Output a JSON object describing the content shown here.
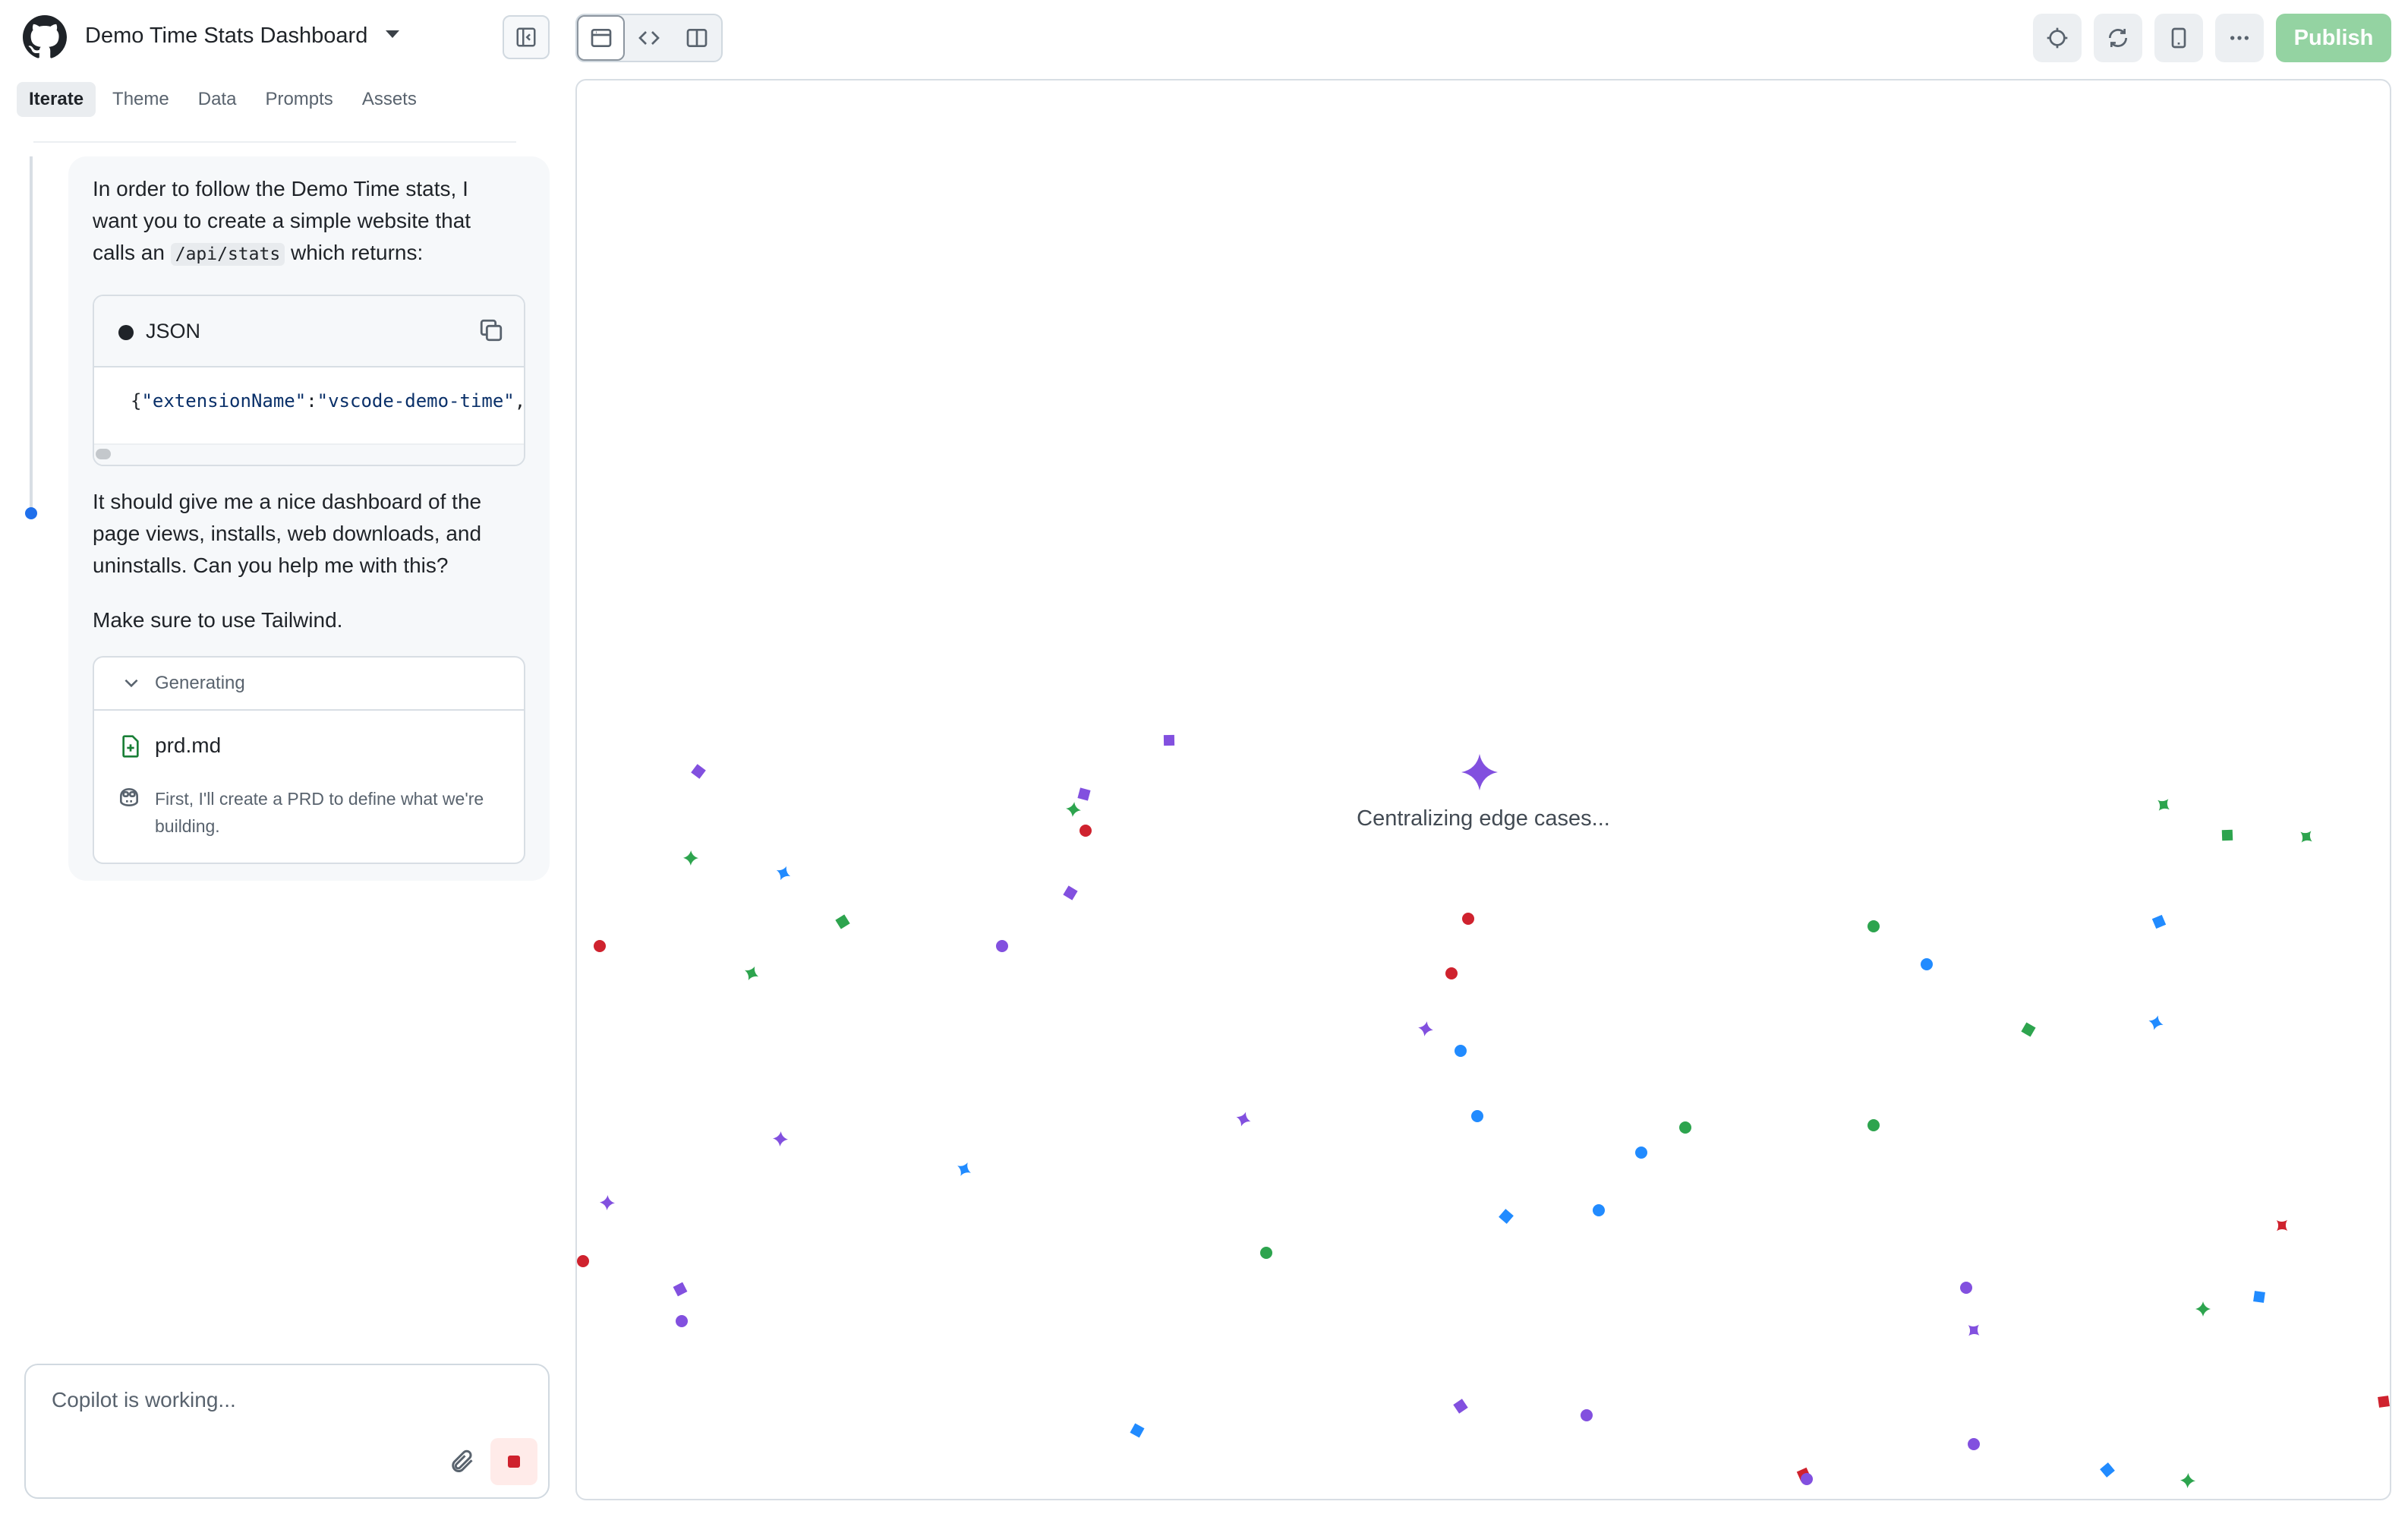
{
  "header": {
    "app_title": "Demo Time Stats Dashboard",
    "publish_label": "Publish",
    "publish_color": "#94d3a2"
  },
  "tabs": [
    {
      "label": "Iterate",
      "active": true
    },
    {
      "label": "Theme",
      "active": false
    },
    {
      "label": "Data",
      "active": false
    },
    {
      "label": "Prompts",
      "active": false
    },
    {
      "label": "Assets",
      "active": false
    }
  ],
  "chat": {
    "message_intro_before": "In order to follow the Demo Time stats, I want you to create a simple website that calls an",
    "message_intro_code": "/api/stats",
    "message_intro_after": "which returns:",
    "code_block": {
      "language": "JSON",
      "brace": "{",
      "key": "\"extensionName\"",
      "colon": ":",
      "value": "\"vscode-demo-time\"",
      "trailing": ","
    },
    "message_dashboard": "It should give me a nice dashboard of the page views, installs, web downloads, and uninstalls. Can you help me with this?",
    "message_tailwind": "Make sure to use Tailwind.",
    "generating": {
      "label": "Generating",
      "file_name": "prd.md",
      "note": "First, I'll create a PRD to define what we're building."
    }
  },
  "prompt": {
    "placeholder": "Copilot is working..."
  },
  "preview": {
    "loading_text": "Centralizing edge cases...",
    "accent_color": "#8250df"
  },
  "colors": {
    "red": "#cf222e",
    "green": "#2da44e",
    "blue": "#218bff",
    "purple": "#8250df"
  }
}
